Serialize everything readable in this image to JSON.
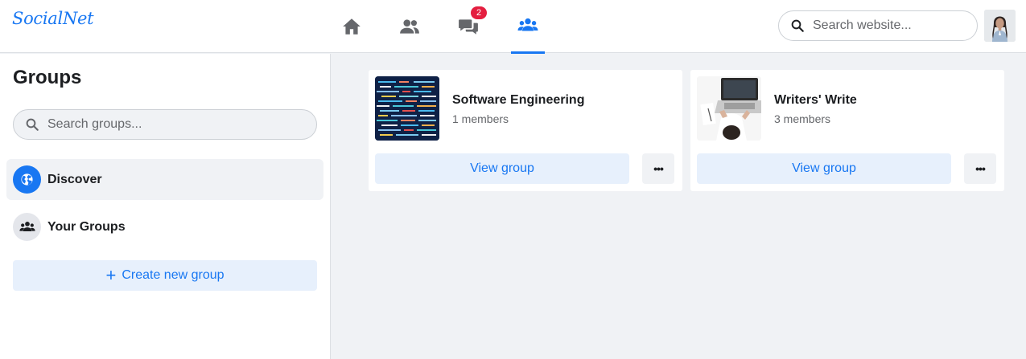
{
  "app": {
    "logo": "SocialNet"
  },
  "nav": {
    "tabs": [
      {
        "name": "home",
        "icon": "home-icon",
        "active": false
      },
      {
        "name": "friends",
        "icon": "friends-icon",
        "active": false
      },
      {
        "name": "messages",
        "icon": "chat-icon",
        "active": false,
        "badge": "2"
      },
      {
        "name": "groups",
        "icon": "groups-icon",
        "active": true
      }
    ]
  },
  "header": {
    "search_placeholder": "Search website..."
  },
  "sidebar": {
    "title": "Groups",
    "search_placeholder": "Search groups...",
    "items": [
      {
        "label": "Discover",
        "icon": "globe-icon",
        "active": true
      },
      {
        "label": "Your Groups",
        "icon": "groups-icon",
        "active": false
      }
    ],
    "create_label": "Create new group"
  },
  "groups": [
    {
      "name": "Software Engineering",
      "members": "1 members",
      "view_label": "View group",
      "more_label": "•••",
      "thumb": "code-screen-image"
    },
    {
      "name": "Writers' Write",
      "members": "3 members",
      "view_label": "View group",
      "more_label": "•••",
      "thumb": "laptop-desk-image"
    }
  ],
  "colors": {
    "accent": "#1877f2",
    "badge": "#e41e3f",
    "light_accent": "#e7f0fc",
    "background": "#f0f2f5"
  }
}
